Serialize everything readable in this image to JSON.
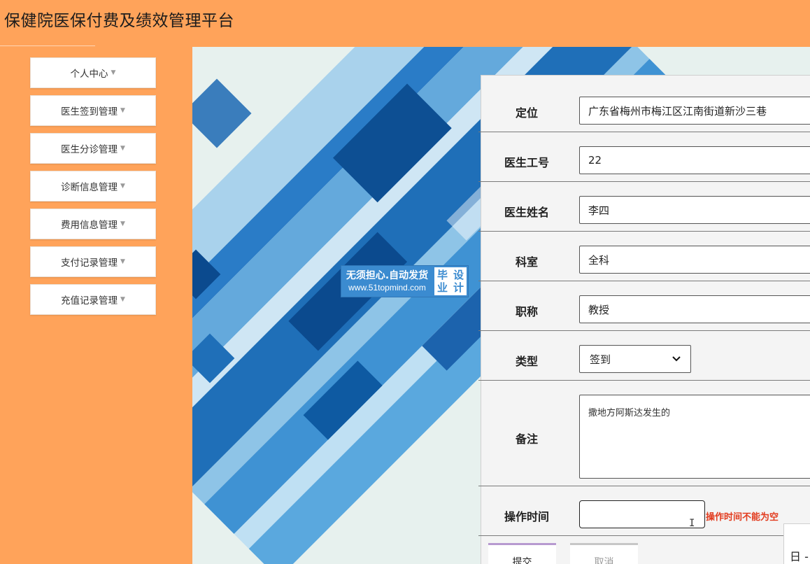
{
  "app": {
    "title": "保健院医保付费及绩效管理平台"
  },
  "sidebar": {
    "caret_glyph": "▼",
    "items": [
      {
        "label": "个人中心"
      },
      {
        "label": "医生签到管理"
      },
      {
        "label": "医生分诊管理"
      },
      {
        "label": "诊断信息管理"
      },
      {
        "label": "费用信息管理"
      },
      {
        "label": "支付记录管理"
      },
      {
        "label": "充值记录管理"
      }
    ]
  },
  "watermark": {
    "line1": "无须担心.自动发货",
    "line2": "www.51topmind.com",
    "badge_line1": "毕业",
    "badge_line2": "设计"
  },
  "form": {
    "location": {
      "label": "定位",
      "value": "广东省梅州市梅江区江南街道新沙三巷"
    },
    "doctor_id": {
      "label": "医生工号",
      "value": "22"
    },
    "doctor_name": {
      "label": "医生姓名",
      "value": "李四"
    },
    "department": {
      "label": "科室",
      "value": "全科"
    },
    "title": {
      "label": "职称",
      "value": "教授"
    },
    "type": {
      "label": "类型",
      "selected": "签到"
    },
    "remark": {
      "label": "备注",
      "value": "撒地方阿斯达发生的"
    },
    "operation_time": {
      "label": "操作时间",
      "value": "",
      "error": "操作时间不能为空"
    },
    "submit_label": "提交",
    "cancel_label": "取消",
    "calendar_glyph": "日 -"
  },
  "colors": {
    "sidebar_bg": "#FFA35A",
    "error": "#E23B1E",
    "banner_blue": "#1F6FB8",
    "submit_accent": "#B79AD0"
  }
}
